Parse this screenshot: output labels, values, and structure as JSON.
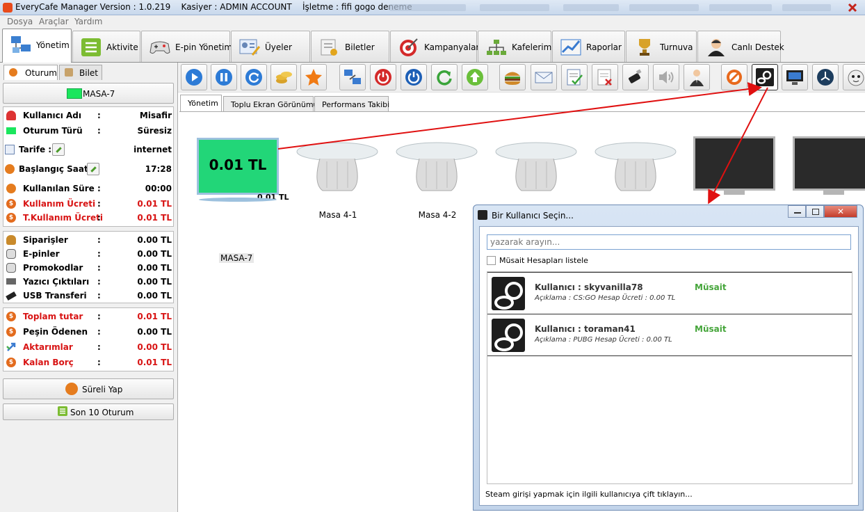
{
  "window": {
    "title": "EveryCafe Manager Version : 1.0.219",
    "kasiyer": "Kasiyer : ADMIN ACCOUNT",
    "isletme": "İşletme : fifi gogo deneme"
  },
  "menu": [
    "Dosya",
    "Araçlar",
    "Yardım"
  ],
  "main_tabs": [
    {
      "label": "Yönetim",
      "icon": "network-computers-icon",
      "active": true
    },
    {
      "label": "Aktivite",
      "icon": "list-icon"
    },
    {
      "label": "E-pin Yönetimi",
      "icon": "gamepad-icon"
    },
    {
      "label": "Üyeler",
      "icon": "member-card-icon"
    },
    {
      "label": "Biletler",
      "icon": "ticket-icon"
    },
    {
      "label": "Kampanyalar",
      "icon": "target-icon"
    },
    {
      "label": "Kafelerim",
      "icon": "hierarchy-icon"
    },
    {
      "label": "Raporlar",
      "icon": "chart-icon"
    },
    {
      "label": "Turnuva",
      "icon": "trophy-icon"
    },
    {
      "label": "Canlı Destek",
      "icon": "support-agent-icon"
    }
  ],
  "left": {
    "subtabs": [
      "Oturum",
      "Bilet"
    ],
    "selected_station": "MASA-7",
    "session": [
      {
        "k": "Kullanıcı Adı",
        "v": "Misafir",
        "icon": "user-icon"
      },
      {
        "k": "Oturum Türü",
        "v": "Süresiz",
        "icon": "monitor-icon"
      },
      {
        "k": "Tarife :",
        "v": "internet",
        "icon": "tariff-icon"
      },
      {
        "k": "Başlangıç Saati :",
        "v": "17:28",
        "icon": "clock-icon"
      },
      {
        "k": "Kullanılan Süre",
        "v": "00:00",
        "icon": "clock-icon"
      },
      {
        "k": "Kullanım Ücreti",
        "v": "0.01 TL",
        "icon": "coin-icon",
        "red": true
      },
      {
        "k": "T.Kullanım Ücreti",
        "v": "0.01 TL",
        "icon": "coin-icon",
        "red": true
      }
    ],
    "orders": [
      {
        "k": "Siparişler",
        "v": "0.00 TL",
        "icon": "burger-icon"
      },
      {
        "k": "E-pinler",
        "v": "0.00 TL",
        "icon": "gamepad-icon"
      },
      {
        "k": "Promokodlar",
        "v": "0.00 TL",
        "icon": "gamepad-icon"
      },
      {
        "k": "Yazıcı Çıktıları",
        "v": "0.00 TL",
        "icon": "printer-icon"
      },
      {
        "k": "USB Transferi",
        "v": "0.00 TL",
        "icon": "usb-icon"
      }
    ],
    "totals": [
      {
        "k": "Toplam tutar",
        "v": "0.01 TL",
        "icon": "coin-icon",
        "red": true
      },
      {
        "k": "Peşin Ödenen",
        "v": "0.00 TL",
        "icon": "coin-icon"
      },
      {
        "k": "Aktarımlar",
        "v": "0.00 TL",
        "icon": "transfer-icon",
        "red": true
      },
      {
        "k": "Kalan Borç",
        "v": "0.01 TL",
        "icon": "coin-icon",
        "red": true
      }
    ],
    "sureli_btn": "Süreli Yap",
    "son10_btn": "Son 10 Oturum"
  },
  "toolbar": [
    "play-icon",
    "pause-icon",
    "refresh-icon",
    "coins-icon",
    "star-icon",
    "transfer-computers-icon",
    "power-red-icon",
    "power-blue-icon",
    "restart-icon",
    "upload-icon",
    "burger-icon",
    "mail-icon",
    "checklist-icon",
    "cancel-list-icon",
    "usb-icon",
    "volume-icon",
    "user-suit-icon",
    "block-icon",
    "steam-icon",
    "screen-icon",
    "clock-dark-icon",
    "mascot-icon"
  ],
  "content_tabs": [
    "Yönetim",
    "Toplu Ekran Görünümü",
    "Performans Takibi"
  ],
  "stations": [
    {
      "name": "MASA-7",
      "amount": "0.01 TL",
      "small_amount": "0.01 TL",
      "type": "active"
    },
    {
      "name": "Masa 4-1",
      "type": "table"
    },
    {
      "name": "Masa 4-2",
      "type": "table"
    },
    {
      "name": "",
      "type": "table"
    },
    {
      "name": "",
      "type": "table"
    },
    {
      "name": "",
      "type": "off"
    },
    {
      "name": "",
      "type": "off"
    }
  ],
  "dialog": {
    "title": "Bir Kullanıcı Seçin...",
    "search_placeholder": "yazarak arayın...",
    "checkbox_label": "Müsait Hesapları listele",
    "users": [
      {
        "user": "Kullanıcı : skyvanilla78",
        "desc": "Açıklama : CS:GO  Hesap Ücreti : 0.00 TL",
        "status": "Müsait"
      },
      {
        "user": "Kullanıcı : toraman41",
        "desc": "Açıklama : PUBG  Hesap Ücreti : 0.00 TL",
        "status": "Müsait"
      }
    ],
    "hint": "Steam girişi yapmak için ilgili kullanıcıya çift tıklayın...",
    "close": "✕"
  },
  "colors": {
    "green": "#22d678",
    "red": "#d81414",
    "status_green": "#45a53a"
  }
}
